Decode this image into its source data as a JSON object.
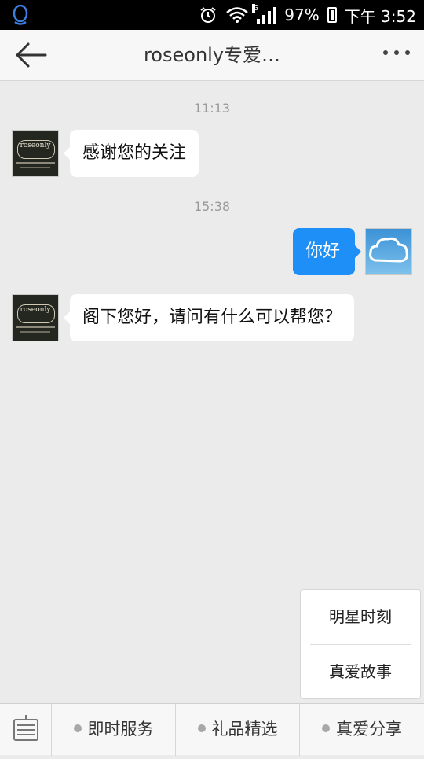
{
  "status_bar": {
    "battery": "97%",
    "time": "下午 3:52",
    "network": "G"
  },
  "header": {
    "title": "roseonly专爱…"
  },
  "chat": {
    "messages": [
      {
        "time": "11:13",
        "side": "left",
        "text": "感谢您的关注"
      },
      {
        "time": "15:38",
        "side": "right",
        "text": "你好"
      },
      {
        "side": "left",
        "text": "阁下您好，请问有什么可以帮您？"
      }
    ]
  },
  "brand_avatar": {
    "text": "roseonly"
  },
  "popup_menu": {
    "items": [
      "明星时刻",
      "真爱故事"
    ]
  },
  "bottom_menu": {
    "tabs": [
      "即时服务",
      "礼品精选",
      "真爱分享"
    ]
  }
}
